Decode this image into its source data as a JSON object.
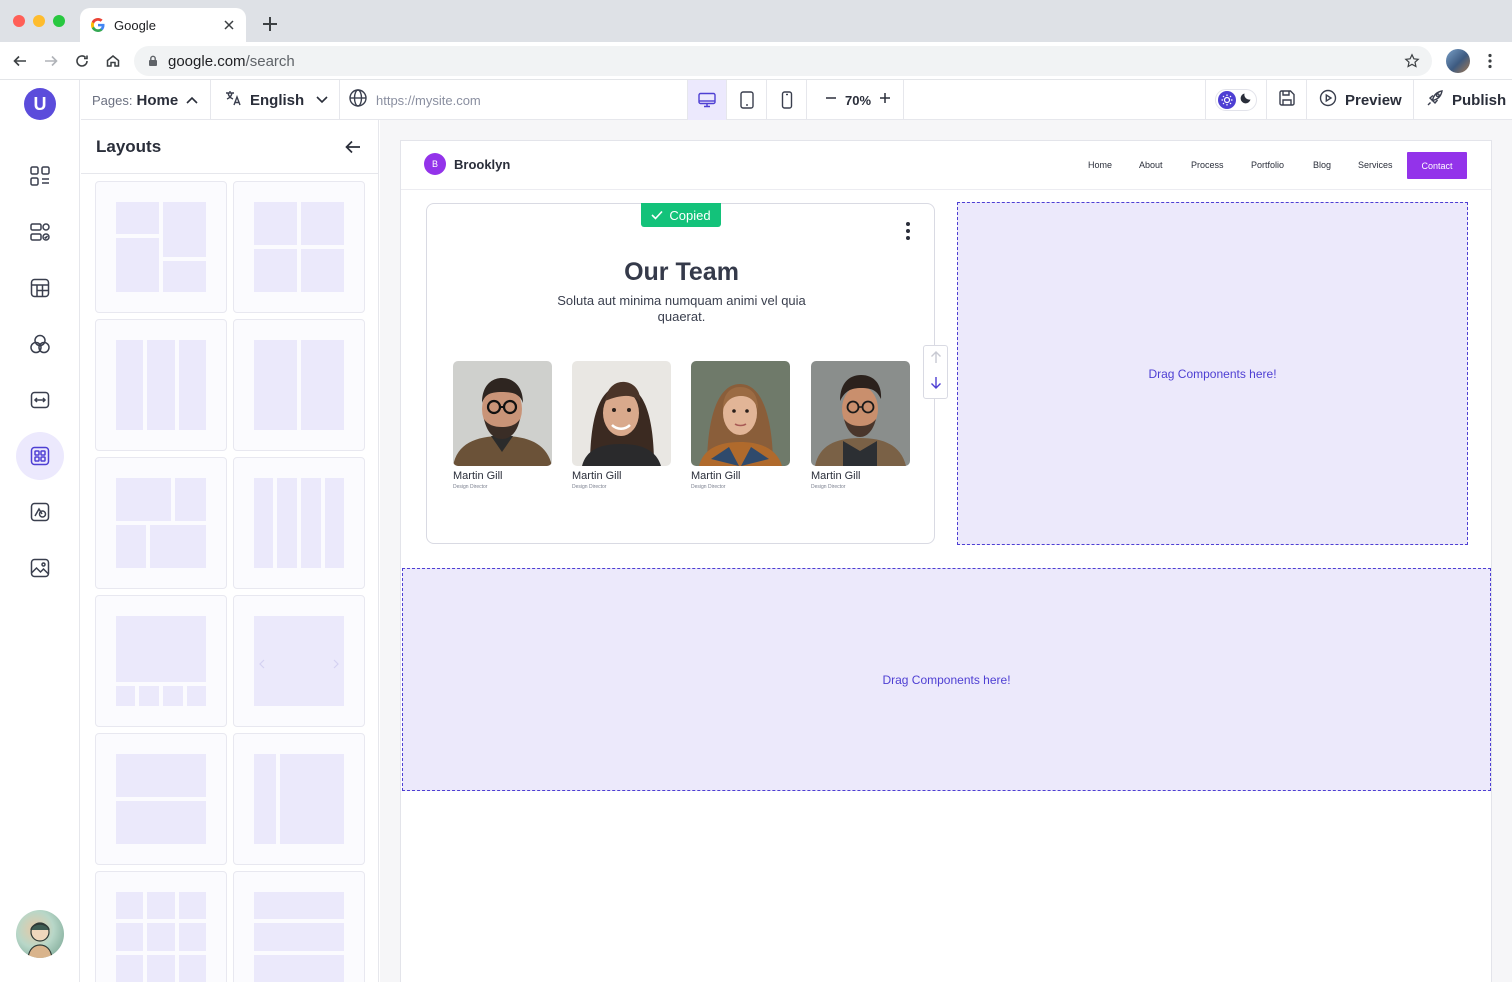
{
  "browser": {
    "tab_title": "Google",
    "url_domain": "google.com",
    "url_path": "/search"
  },
  "toolbar": {
    "pages_label": "Pages:",
    "pages_value": "Home",
    "language": "English",
    "site_url": "https://mysite.com",
    "zoom": "70%",
    "preview_label": "Preview",
    "publish_label": "Publish"
  },
  "rail": {
    "logo_letter": "U",
    "items": [
      "grid-icon",
      "checklist-icon",
      "table-icon",
      "shapes-icon",
      "resize-horizontal-icon",
      "layouts-icon",
      "media-shapes-icon",
      "image-icon"
    ],
    "active_item": "layouts-icon"
  },
  "panel": {
    "title": "Layouts"
  },
  "site": {
    "brand_initial": "B",
    "brand_name": "Brooklyn",
    "nav": [
      "Home",
      "About",
      "Process",
      "Portfolio",
      "Blog",
      "Services"
    ],
    "cta": "Contact"
  },
  "team": {
    "badge": "Copied",
    "title": "Our Team",
    "subtitle": "Soluta aut minima numquam animi vel quia quaerat.",
    "members": [
      {
        "name": "Martin Gill",
        "role": "Design Director"
      },
      {
        "name": "Martin Gill",
        "role": "Design Director"
      },
      {
        "name": "Martin Gill",
        "role": "Design Director"
      },
      {
        "name": "Martin Gill",
        "role": "Design Director"
      }
    ]
  },
  "dropzones": {
    "right_text": "Drag Components here!",
    "bottom_text": "Drag Components here!"
  },
  "colors": {
    "accent": "#4e3fd3",
    "brand_purple": "#9333ea",
    "success": "#13c27a",
    "dropzone_fill": "#ece9fb"
  }
}
